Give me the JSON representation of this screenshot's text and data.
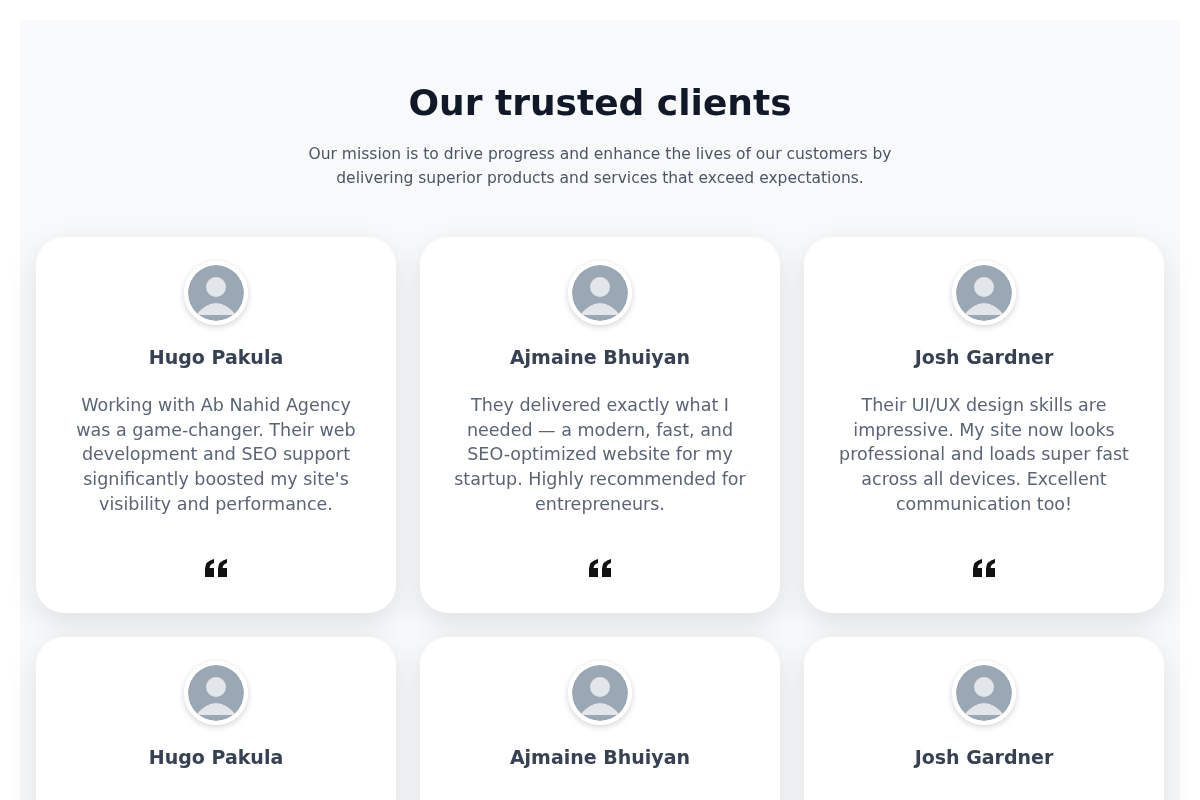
{
  "section": {
    "title": "Our trusted clients",
    "subtitle": "Our mission is to drive progress and enhance the lives of our customers by delivering superior products and services that exceed expectations."
  },
  "testimonials": [
    {
      "name": "Hugo Pakula",
      "quote": "Working with Ab Nahid Agency was a game-changer. Their web development and SEO support significantly boosted my site's visibility and performance."
    },
    {
      "name": "Ajmaine Bhuiyan",
      "quote": "They delivered exactly what I needed — a modern, fast, and SEO-optimized website for my startup. Highly recommended for entrepreneurs."
    },
    {
      "name": "Josh Gardner",
      "quote": "Their UI/UX design skills are impressive. My site now looks professional and loads super fast across all devices. Excellent communication too!"
    },
    {
      "name": "Hugo Pakula"
    },
    {
      "name": "Ajmaine Bhuiyan"
    },
    {
      "name": "Josh Gardner"
    }
  ]
}
